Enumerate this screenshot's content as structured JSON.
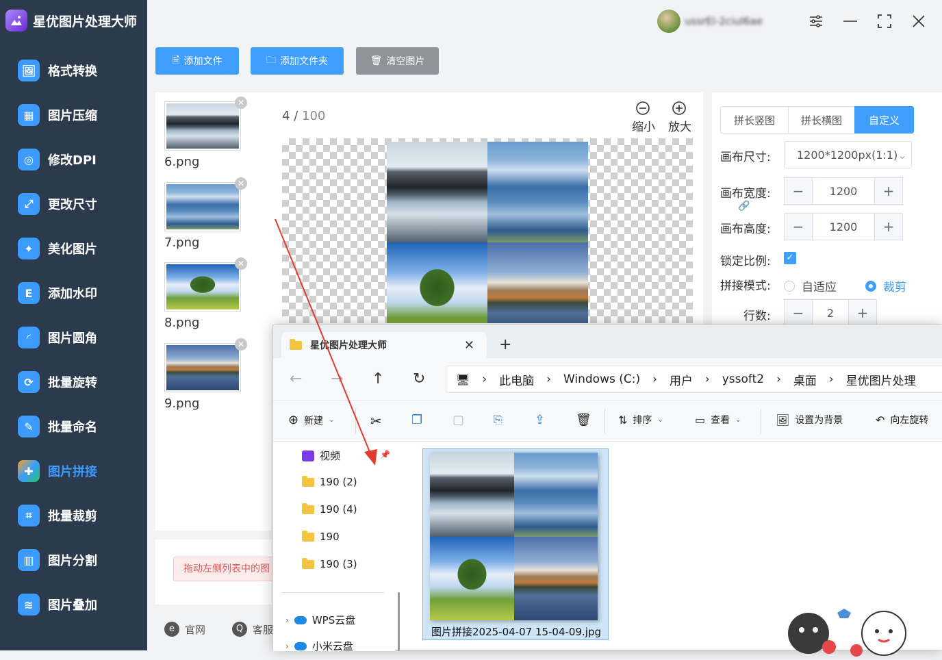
{
  "app": {
    "title": "星优图片处理大师",
    "username": "ussrEl-2ciul6ae"
  },
  "sidebar": {
    "items": [
      {
        "label": "格式转换",
        "icon": "image-convert-icon",
        "color": "#3b9bff"
      },
      {
        "label": "图片压缩",
        "icon": "image-compress-icon",
        "color": "#3b9bff"
      },
      {
        "label": "修改DPI",
        "icon": "dpi-icon",
        "color": "#3b9bff"
      },
      {
        "label": "更改尺寸",
        "icon": "resize-icon",
        "color": "#3b9bff"
      },
      {
        "label": "美化图片",
        "icon": "beautify-icon",
        "color": "#3b9bff"
      },
      {
        "label": "添加水印",
        "icon": "watermark-icon",
        "color": "#3b9bff"
      },
      {
        "label": "图片圆角",
        "icon": "round-corner-icon",
        "color": "#3b9bff"
      },
      {
        "label": "批量旋转",
        "icon": "rotate-icon",
        "color": "#3b9bff"
      },
      {
        "label": "批量命名",
        "icon": "rename-icon",
        "color": "#3b9bff"
      },
      {
        "label": "图片拼接",
        "icon": "puzzle-icon",
        "color": "#3b9bff",
        "active": true
      },
      {
        "label": "批量裁剪",
        "icon": "crop-icon",
        "color": "#3b9bff"
      },
      {
        "label": "图片分割",
        "icon": "split-icon",
        "color": "#3b9bff"
      },
      {
        "label": "图片叠加",
        "icon": "layers-icon",
        "color": "#3b9bff"
      }
    ]
  },
  "toolbar": {
    "add_file": "添加文件",
    "add_folder": "添加文件夹",
    "clear": "清空图片"
  },
  "files": [
    {
      "name": "6.png"
    },
    {
      "name": "7.png"
    },
    {
      "name": "8.png"
    },
    {
      "name": "9.png"
    }
  ],
  "preview": {
    "current": "4",
    "separator": "/",
    "total": "100",
    "zoom_out": "缩小",
    "zoom_in": "放大"
  },
  "settings": {
    "modes": [
      "拼长竖图",
      "拼长横图",
      "自定义"
    ],
    "active_mode": "自定义",
    "canvas_size_label": "画布尺寸:",
    "canvas_size_value": "1200*1200px(1:1)",
    "width_label": "画布宽度:",
    "width_value": "1200",
    "height_label": "画布高度:",
    "height_value": "1200",
    "lock_label": "锁定比例:",
    "lock_checked": true,
    "stitch_label": "拼接模式:",
    "stitch_options": [
      "自适应",
      "裁剪"
    ],
    "stitch_selected": "裁剪",
    "rows_label": "行数:",
    "rows_value": "2",
    "accent": "#409eff"
  },
  "tip": {
    "text": "拖动左侧列表中的图"
  },
  "footer": {
    "official": "官网",
    "service": "客服"
  },
  "explorer": {
    "tab_title": "星优图片处理大师",
    "breadcrumbs": [
      "此电脑",
      "Windows (C:)",
      "用户",
      "yssoft2",
      "桌面",
      "星优图片处理"
    ],
    "commands": {
      "new": "新建",
      "sort": "排序",
      "view": "查看",
      "set_bg": "设置为背景",
      "rotate_left": "向左旋转"
    },
    "tree": [
      {
        "label": "视频",
        "type": "video"
      },
      {
        "label": "190 (2)",
        "type": "folder"
      },
      {
        "label": "190 (4)",
        "type": "folder"
      },
      {
        "label": "190",
        "type": "folder"
      },
      {
        "label": "190 (3)",
        "type": "folder"
      },
      {
        "label": "WPS云盘",
        "type": "cloud"
      },
      {
        "label": "小米云盘",
        "type": "cloud"
      }
    ],
    "file": {
      "name": "图片拼接2025-04-07 15-04-09.jpg"
    }
  }
}
